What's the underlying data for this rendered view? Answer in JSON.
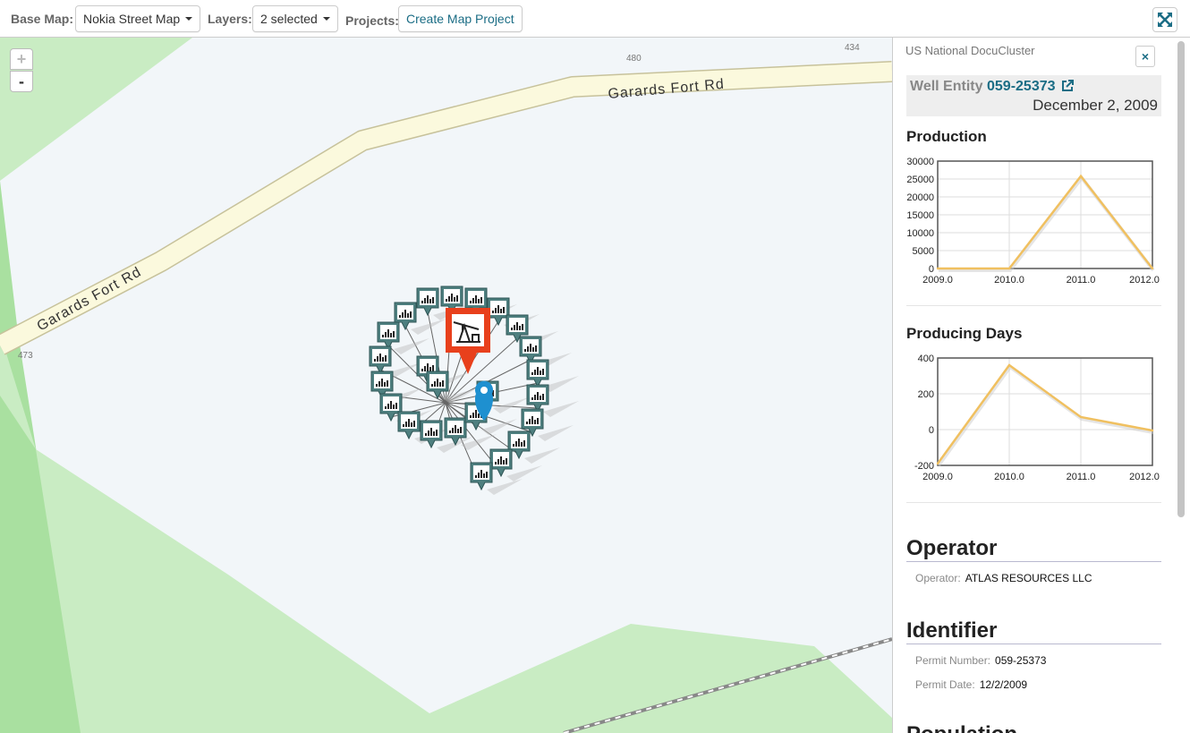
{
  "toolbar": {
    "basemap_label": "Base Map:",
    "basemap_value": "Nokia Street Map",
    "layers_label": "Layers:",
    "layers_value": "2 selected",
    "projects_label": "Projects:",
    "create_project": "Create Map Project"
  },
  "map": {
    "zoom_in": "+",
    "zoom_out": "-",
    "road_names": [
      "Garards Fort Rd",
      "Garards Fort Rd"
    ],
    "elevations": [
      "480",
      "434",
      "473"
    ]
  },
  "panel": {
    "source": "US National DocuCluster",
    "close": "×",
    "entity_label": "Well Entity",
    "entity_id": "059-25373",
    "entity_date": "December 2, 2009",
    "sections": {
      "operator": {
        "title": "Operator",
        "operator_key": "Operator:",
        "operator_value": "ATLAS RESOURCES LLC"
      },
      "identifier": {
        "title": "Identifier",
        "permit_number_key": "Permit Number:",
        "permit_number_value": "059-25373",
        "permit_date_key": "Permit Date:",
        "permit_date_value": "12/2/2009"
      },
      "next_partial": "Population"
    }
  },
  "colors": {
    "accent": "#1b6d85",
    "line": "#f0c060",
    "marker": "#e8401c",
    "pin": "#1e90d0"
  },
  "chart_data": [
    {
      "type": "line",
      "title": "Production",
      "x": [
        2009,
        2010,
        2011,
        2012
      ],
      "x_tick_labels": [
        "2009.0",
        "2010.0",
        "2011.0",
        "2012.0"
      ],
      "values": [
        0,
        0,
        25800,
        0
      ],
      "ylim": [
        0,
        30000
      ],
      "y_ticks": [
        "0",
        "5000",
        "10000",
        "15000",
        "20000",
        "25000",
        "30000"
      ],
      "grid": true
    },
    {
      "type": "line",
      "title": "Producing Days",
      "x": [
        2009,
        2010,
        2011,
        2012
      ],
      "x_tick_labels": [
        "2009.0",
        "2010.0",
        "2011.0",
        "2012.0"
      ],
      "values": [
        -190,
        360,
        70,
        -5
      ],
      "ylim": [
        -200,
        400
      ],
      "y_ticks": [
        "-200",
        "0",
        "200",
        "400"
      ],
      "grid": true
    }
  ]
}
